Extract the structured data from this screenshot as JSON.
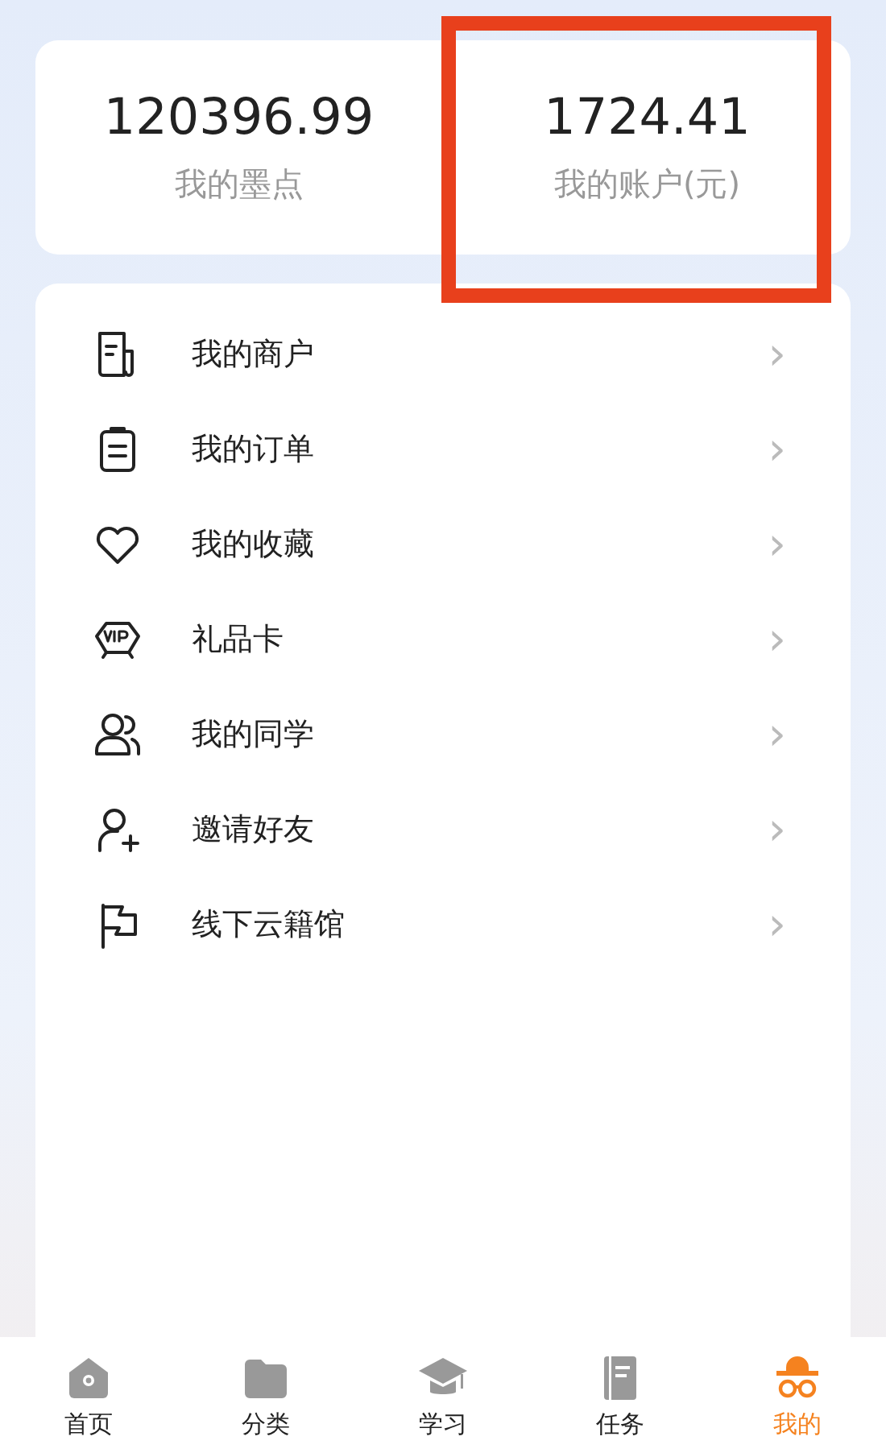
{
  "stats": [
    {
      "value": "120396.99",
      "label": "我的墨点",
      "highlighted": false
    },
    {
      "value": "1724.41",
      "label": "我的账户(元)",
      "highlighted": true
    }
  ],
  "menu": [
    {
      "label": "我的商户",
      "chevron": "›"
    },
    {
      "label": "我的订单",
      "chevron": "›"
    },
    {
      "label": "我的收藏",
      "chevron": "›"
    },
    {
      "label": "礼品卡",
      "chevron": "›"
    },
    {
      "label": "我的同学",
      "chevron": "›"
    },
    {
      "label": "邀请好友",
      "chevron": "›"
    },
    {
      "label": "线下云籍馆",
      "chevron": "›"
    }
  ],
  "tab_bar": [
    {
      "label": "首页",
      "selected": false
    },
    {
      "label": "分类",
      "selected": false
    },
    {
      "label": "学习",
      "selected": false
    },
    {
      "label": "任务",
      "selected": false
    },
    {
      "label": "我的",
      "selected": true
    }
  ]
}
